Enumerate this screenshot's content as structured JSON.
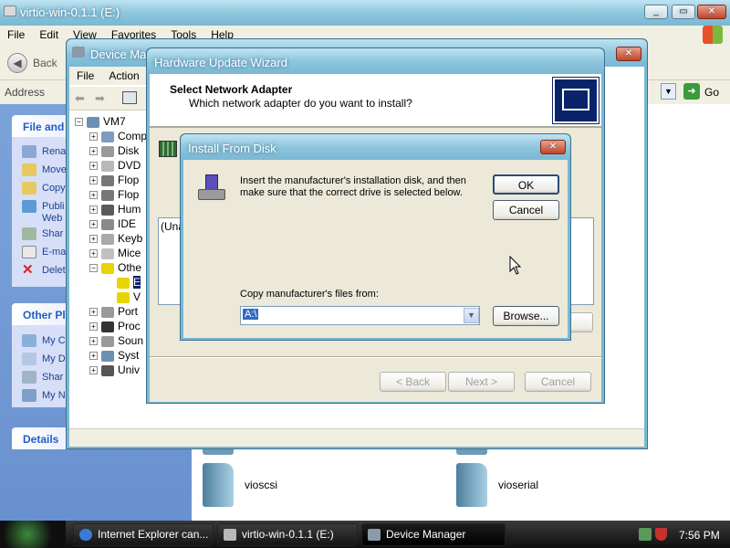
{
  "explorer": {
    "title": "virtio-win-0.1.1 (E:)",
    "menu": [
      "File",
      "Edit",
      "View",
      "Favorites",
      "Tools",
      "Help"
    ],
    "back_label": "Back",
    "address_label": "Address",
    "go_label": "Go",
    "task_panes": {
      "file_and_folder": "File and",
      "other_places": "Other Pl",
      "details": "Details"
    },
    "file_tasks": [
      "Rena",
      "Move",
      "Copy",
      "Publi",
      "Web",
      "Shar",
      "E-ma",
      "Delet"
    ],
    "other_places_items": [
      "My C",
      "My D",
      "Shar",
      "My N"
    ],
    "folders": [
      "vioscsi",
      "vioserial"
    ]
  },
  "device_manager": {
    "title": "Device Mana",
    "menu": [
      "File",
      "Action"
    ],
    "tree_root": "VM7",
    "tree_items": [
      "Comp",
      "Disk",
      "DVD",
      "Flop",
      "Flop",
      "Hum",
      "IDE",
      "Keyb",
      "Mice",
      "Othe",
      "E",
      "V",
      "Port",
      "Proc",
      "Soun",
      "Syst",
      "Univ"
    ]
  },
  "wizard": {
    "title": "Hardware Update Wizard",
    "heading": "Select Network Adapter",
    "subheading": "Which network adapter do you want to install?",
    "list_partial": "(Una",
    "back_label": "< Back",
    "next_label": "Next >",
    "cancel_label": "Cancel"
  },
  "dialog": {
    "title": "Install From Disk",
    "message": "Insert the manufacturer's installation disk, and then make sure that the correct drive is selected below.",
    "ok_label": "OK",
    "cancel_label": "Cancel",
    "copy_label": "Copy manufacturer's files from:",
    "copy_value": "A:\\",
    "browse_label": "Browse..."
  },
  "taskbar": {
    "items": [
      "Internet Explorer can...",
      "virtio-win-0.1.1 (E:)",
      "Device Manager"
    ],
    "clock": "7:56 PM"
  },
  "colors": {
    "accent": "#0a246a",
    "taskbar": "#151515",
    "side_pane": "#7ba3d9",
    "title_gradient": "#8ec6dd"
  }
}
